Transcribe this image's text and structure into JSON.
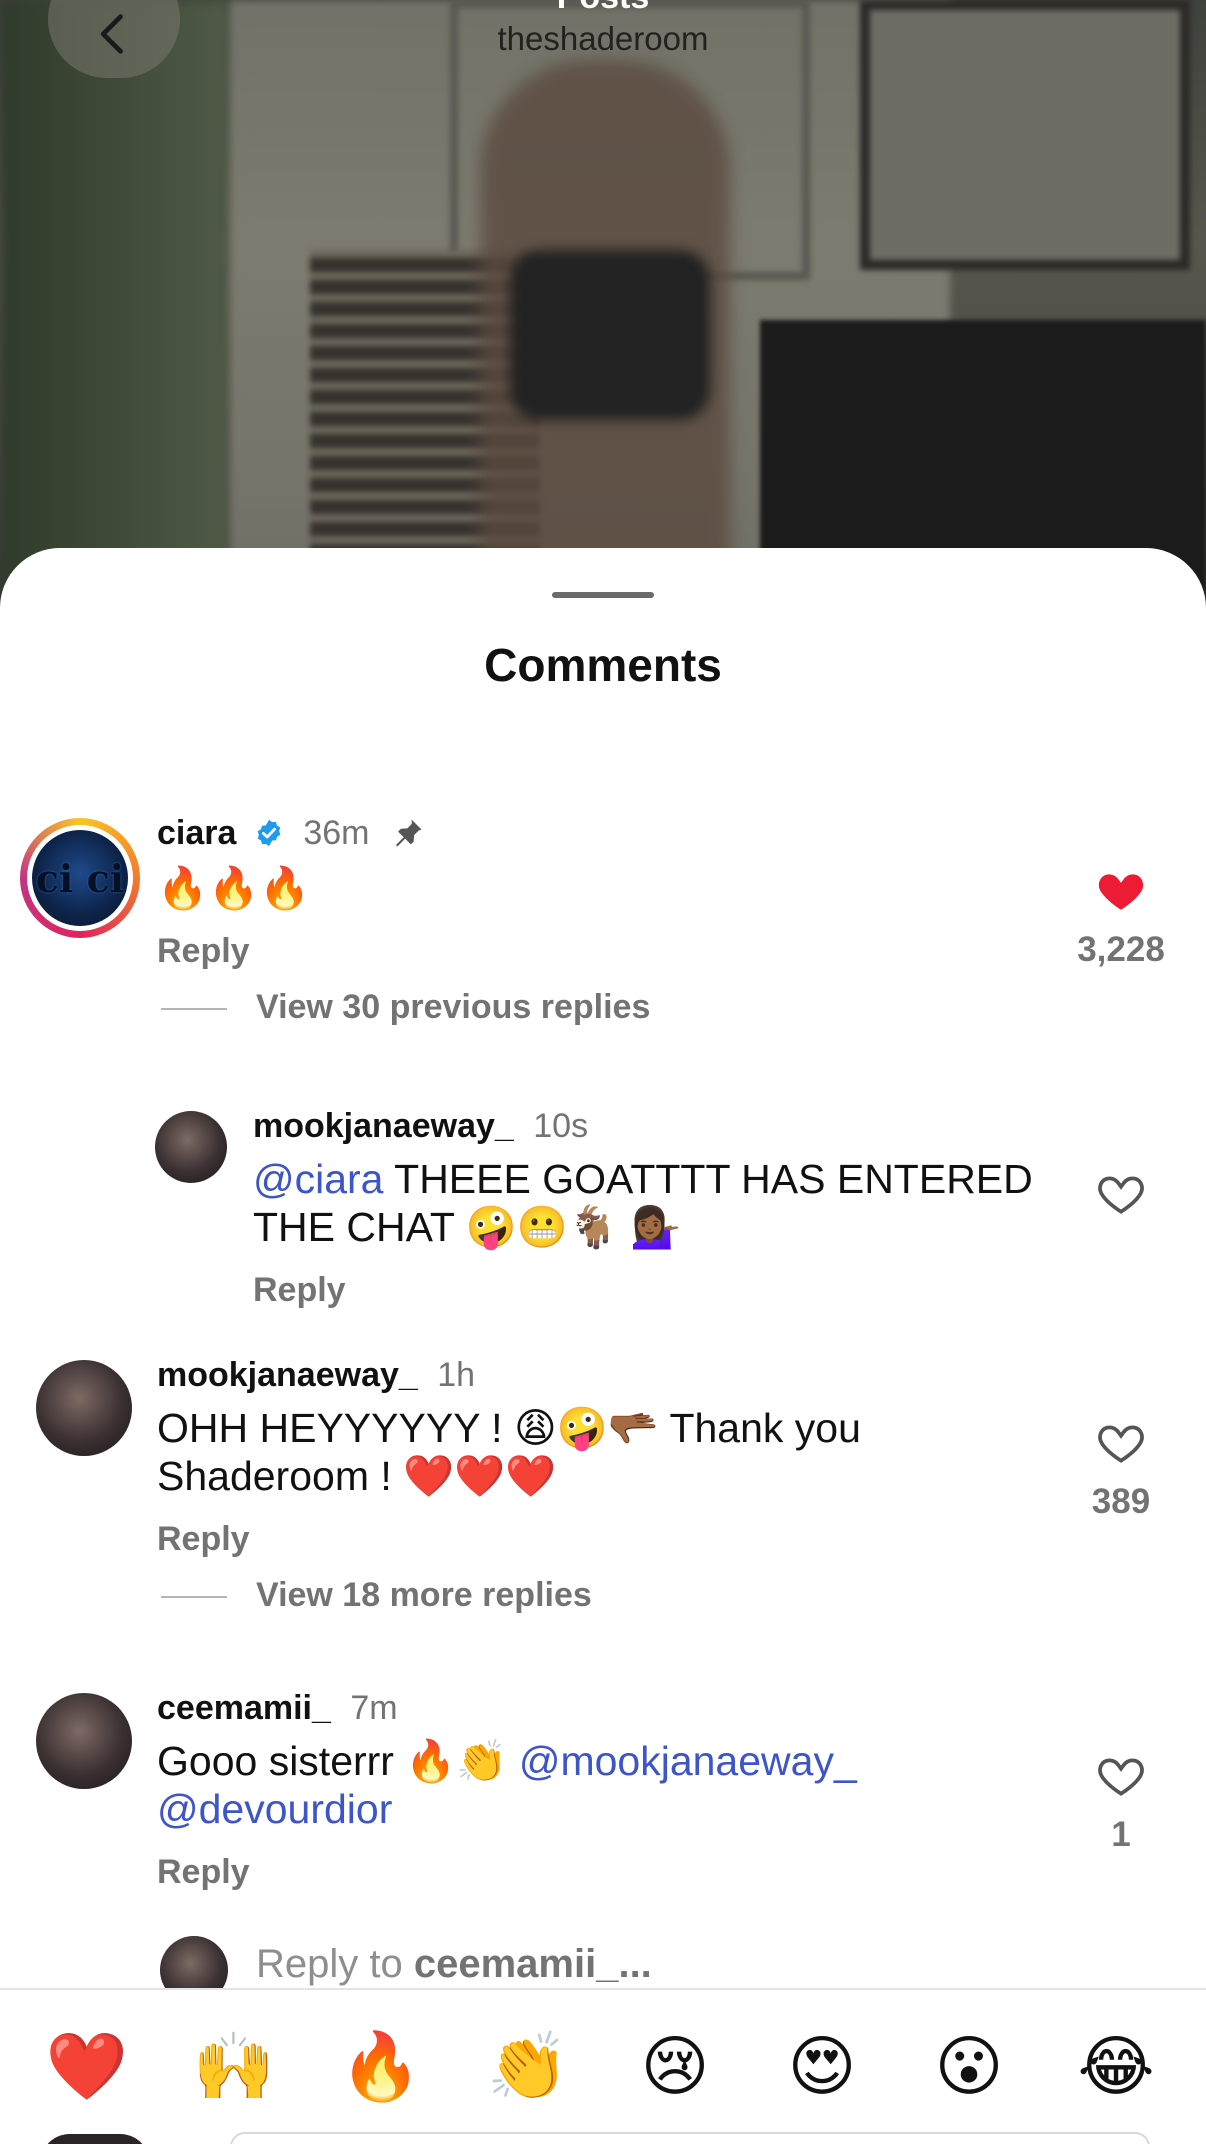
{
  "header": {
    "title": "Posts",
    "username": "theshaderoom"
  },
  "sheet": {
    "title": "Comments"
  },
  "comments": [
    {
      "username": "ciara",
      "verified": true,
      "pinned": true,
      "time": "36m",
      "text": "🔥🔥🔥",
      "reply_label": "Reply",
      "liked": true,
      "like_count": "3,228",
      "view_replies": "View 30 previous replies"
    },
    {
      "username": "mookjanaeway_",
      "time": "10s",
      "mention": "@ciara",
      "text": " THEEE GOATTTT HAS ENTERED THE CHAT 🤪😬🐐 💁🏾‍♀️",
      "reply_label": "Reply",
      "liked": false,
      "like_count": ""
    },
    {
      "username": "mookjanaeway_",
      "time": "1h",
      "text": "OHH HEYYYYYY ! 😩🤪🫳🏾 Thank you Shaderoom ! ❤️❤️❤️",
      "reply_label": "Reply",
      "liked": false,
      "like_count": "389",
      "view_replies": "View 18 more replies"
    },
    {
      "username": "ceemamii_",
      "time": "7m",
      "text": "Gooo sisterrr 🔥👏 ",
      "mention1": "@mookjanaeway_",
      "mention2": "@devourdior",
      "reply_label": "Reply",
      "liked": false,
      "like_count": "1"
    }
  ],
  "reply_input": {
    "prefix": "Reply to ",
    "target": "ceemamii_..."
  },
  "emoji_bar": [
    "❤️",
    "🙌",
    "🔥",
    "👏",
    "😢",
    "😍",
    "😮",
    "😂"
  ],
  "colors": {
    "liked_heart": "#ed1c34",
    "mention": "#3d55c9",
    "secondary_text": "#737373",
    "verified": "#1d9bf0"
  }
}
